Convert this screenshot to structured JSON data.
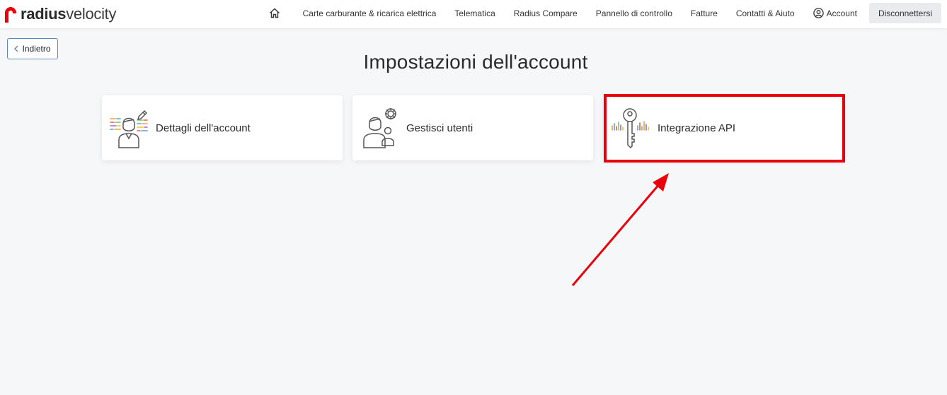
{
  "brand": {
    "name_bold": "radius",
    "name_light": "velocity",
    "color": "#e8000b"
  },
  "nav": {
    "home_icon": "home-icon",
    "items": [
      "Carte carburante & ricarica elettrica",
      "Telematica",
      "Radius Compare",
      "Pannello di controllo",
      "Fatture",
      "Contatti & Aiuto"
    ],
    "account_icon": "user-circle-icon",
    "account_label": "Account",
    "logout_label": "Disconnettersi"
  },
  "back": {
    "label": "Indietro",
    "icon": "chevron-left-icon"
  },
  "page": {
    "title": "Impostazioni dell'account"
  },
  "cards": [
    {
      "label": "Dettagli dell'account",
      "icon": "account-details-icon"
    },
    {
      "label": "Gestisci utenti",
      "icon": "manage-users-icon"
    },
    {
      "label": "Integrazione API",
      "icon": "api-key-icon"
    }
  ],
  "annotation": {
    "color": "#e8000b"
  }
}
